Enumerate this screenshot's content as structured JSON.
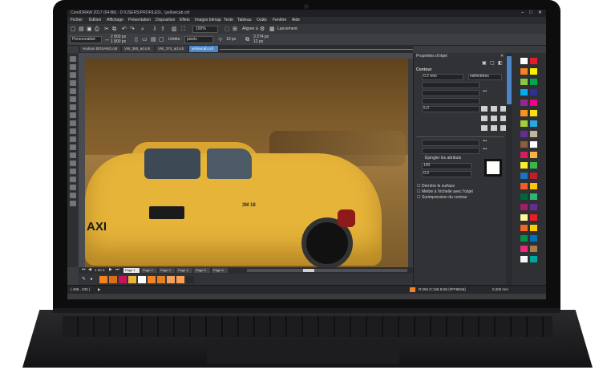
{
  "app": {
    "title": "CorelDRAW 2017 (64-Bit) - D:\\USERS\\PROFILES\\...\\yellowcab.cdr"
  },
  "menu": [
    "Fichier",
    "Édition",
    "Affichage",
    "Présentation",
    "Disposition",
    "Effets",
    "Images bitmap",
    "Texte",
    "Tableau",
    "Outils",
    "Fenêtre",
    "Aide"
  ],
  "toolbar": {
    "zoom": "100%",
    "snap_label": "Aligner à",
    "launch_label": "Lancement"
  },
  "propbar": {
    "preset": "Personnalisé",
    "width": "2 800 px",
    "height": "1 800 px",
    "units_label": "Unités :",
    "units": "pixels",
    "nudge": "10 px",
    "dup_x": "3 274 px",
    "dup_y": "12 px"
  },
  "doc_tabs": [
    "Hudson BOSANO.cdr",
    "VW_360_ad.cdr",
    "VW_374_ad.cdr",
    "yellowcab.cdr"
  ],
  "canvas": {
    "taxi_text": "AXI",
    "roof_number": "3M 18"
  },
  "docker": {
    "title": "Propriétés d'objet",
    "section": "Contour",
    "width": "0.2 mm",
    "width_units": "millimètres",
    "miter": "5.0",
    "behind_label": "Derrière le surface",
    "scale_label": "Mettre à l'échelle avec l'objet",
    "overprint_label": "Surimpression du contour",
    "attr_label": "Épingler les attributs",
    "angle1": "100",
    "angle2": "0.0"
  },
  "pages": {
    "nav": "1 de 6",
    "tabs": [
      "Page 1",
      "Page 2",
      "Page 3",
      "Page 4",
      "Page 5",
      "Page 6"
    ]
  },
  "status": {
    "coords": "( 498 , 230 )",
    "cursor_hint": "▶",
    "color_info": "R:255 G:158 B:86 (#FF9E56)",
    "fill_info": "0.200 mm"
  },
  "colors": {
    "accent": "#4a86c8",
    "cab_yellow": "#e7b43a",
    "palette_swatches": [
      "#ffffff",
      "#e41e26",
      "#f58220",
      "#fff200",
      "#8dc63f",
      "#00a651",
      "#00aeef",
      "#2e3192",
      "#92278f",
      "#ec008c",
      "#f7941d",
      "#ffde17",
      "#a6ce39",
      "#27aae1",
      "#662d91",
      "#c2b59b",
      "#8b5e3c",
      "#ffffff",
      "#d91c5c",
      "#fbb040",
      "#f9ed32",
      "#39b54a",
      "#1c75bc",
      "#be1e2d",
      "#f15a29",
      "#ffc20e",
      "#006838",
      "#2bb673",
      "#9e1f63",
      "#662d91",
      "#fff799",
      "#ed1c24",
      "#f26522",
      "#ffcb05",
      "#009444",
      "#0072bc",
      "#ee2a7b",
      "#a97c50",
      "#f7f7f7",
      "#00a79d"
    ],
    "document_palette": [
      "#f58220",
      "#d96f1a",
      "#c2185b",
      "#e8b33a",
      "#ffffff",
      "#f58220",
      "#e67e22",
      "#f0a35c",
      "#ff9e56",
      "#2a2a2a"
    ]
  }
}
